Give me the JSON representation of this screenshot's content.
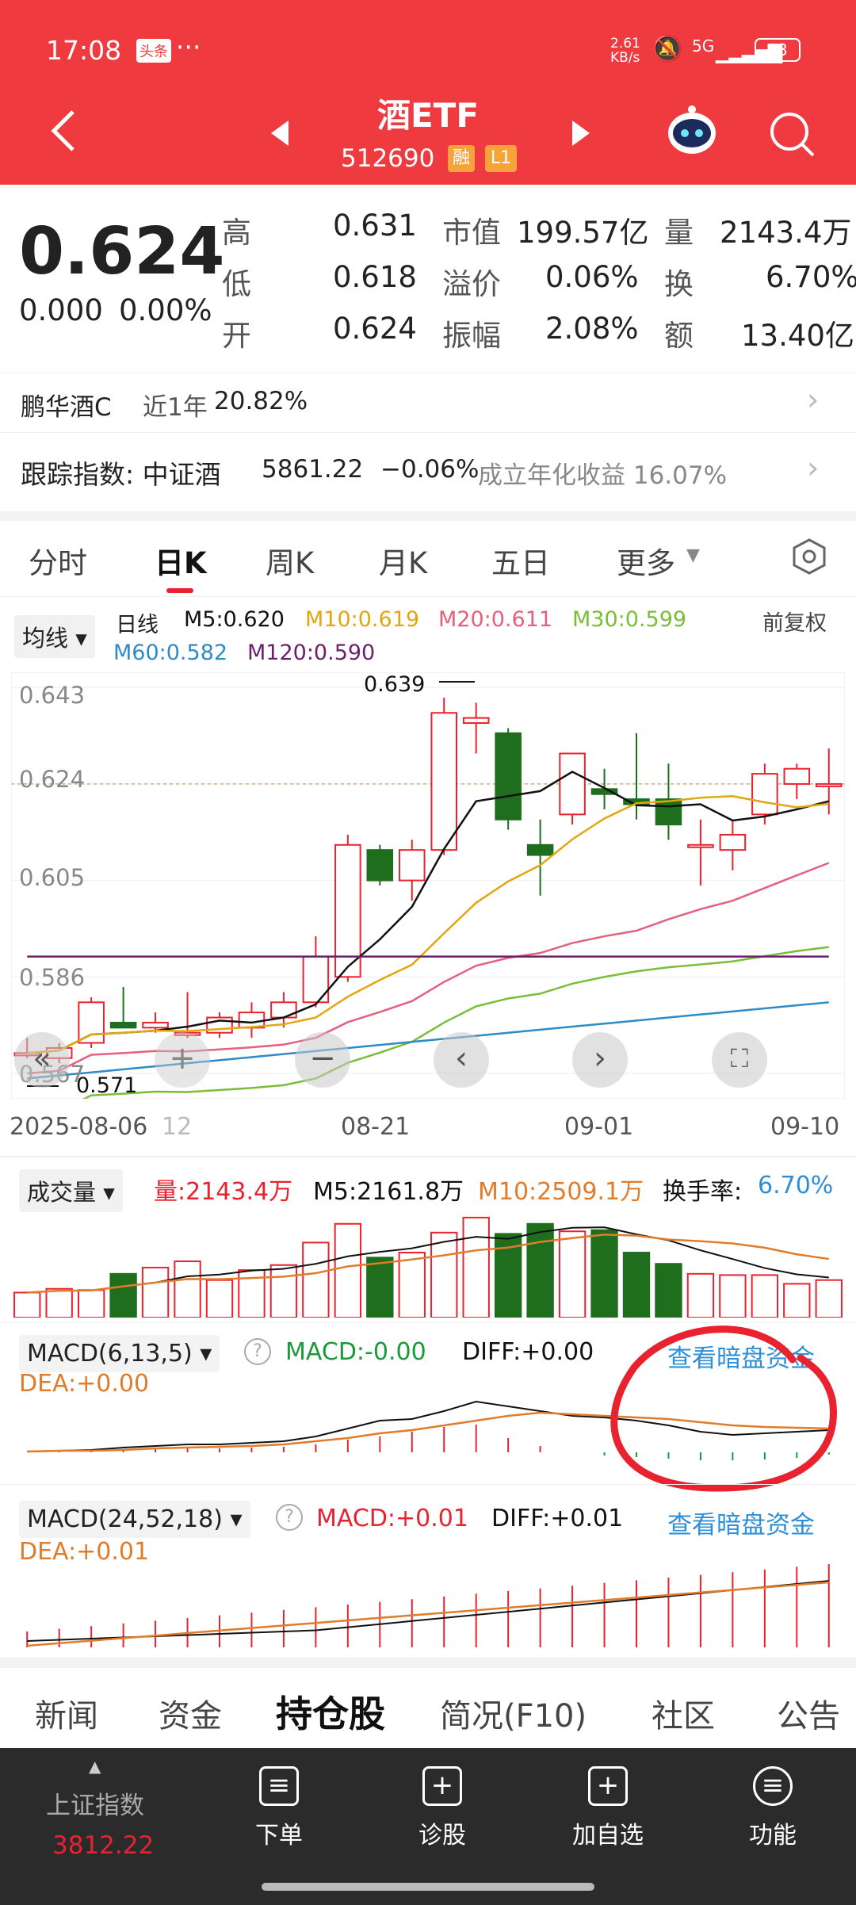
{
  "status": {
    "time": "17:08",
    "app_badge": "头条",
    "dots": "···",
    "speed": "2.61\nKB/s",
    "net": "5G",
    "battery": "53"
  },
  "header": {
    "title": "酒ETF",
    "code": "512690",
    "badge1": "融",
    "badge2": "L1"
  },
  "quote": {
    "price": "0.624",
    "change": "0.000",
    "change_pct": "0.00%",
    "high_label": "高",
    "high": "0.631",
    "low_label": "低",
    "low": "0.618",
    "open_label": "开",
    "open": "0.624",
    "mcap_label": "市值",
    "mcap": "199.57亿",
    "premium_label": "溢价",
    "premium": "0.06%",
    "amp_label": "振幅",
    "amp": "2.08%",
    "vol_label": "量",
    "vol": "2143.4万",
    "turn_label": "换",
    "turn": "6.70%",
    "amt_label": "额",
    "amt": "13.40亿"
  },
  "fund": {
    "name": "鹏华酒C",
    "period": "近1年",
    "ret": "20.82%"
  },
  "tracking": {
    "label": "跟踪指数: 中证酒",
    "value": "5861.22",
    "change": "−0.06%",
    "annual": "成立年化收益 16.07%"
  },
  "tabs": [
    "分时",
    "日K",
    "周K",
    "月K",
    "五日",
    "更多"
  ],
  "kchart": {
    "ma_selector": "均线",
    "period": "日线",
    "m5": "M5:0.620",
    "m10": "M10:0.619",
    "m20": "M20:0.611",
    "m30": "M30:0.599",
    "m60": "M60:0.582",
    "m120": "M120:0.590",
    "adjust": "前复权",
    "y_ticks": [
      "0.643",
      "0.624",
      "0.605",
      "0.586",
      "0.567"
    ],
    "max_label": "0.639",
    "min_label": "0.571",
    "x_ticks": [
      "2025-08-06",
      "12",
      "08-21",
      "09-01",
      "09-10"
    ]
  },
  "volume": {
    "selector": "成交量",
    "vol": "量:2143.4万",
    "m5": "M5:2161.8万",
    "m10": "M10:2509.1万",
    "turn_label": "换手率:",
    "turn": "6.70%"
  },
  "macd1": {
    "selector": "MACD(6,13,5)",
    "macd": "MACD:-0.00",
    "diff": "DIFF:+0.00",
    "dea": "DEA:+0.00",
    "link": "查看暗盘资金"
  },
  "macd2": {
    "selector": "MACD(24,52,18)",
    "macd": "MACD:+0.01",
    "diff": "DIFF:+0.01",
    "dea": "DEA:+0.01",
    "link": "查看暗盘资金"
  },
  "bottom_tabs": [
    "新闻",
    "资金",
    "持仓股",
    "简况(F10)",
    "社区",
    "公告"
  ],
  "nav": {
    "index_name": "上证指数",
    "index_value": "3812.22",
    "items": [
      "下单",
      "诊股",
      "加自选",
      "功能"
    ]
  },
  "colors": {
    "header": "#ef3a3f",
    "up": "#e8222e",
    "down": "#1e6e1e"
  },
  "chart_data": [
    {
      "type": "candlestick",
      "title": "日线",
      "ylim": [
        0.562,
        0.646
      ],
      "x_labels": [
        "2025-08-06",
        "08-21",
        "09-01",
        "09-10"
      ],
      "candles": [
        [
          0.571,
          0.574,
          0.57,
          0.571
        ],
        [
          0.57,
          0.573,
          0.569,
          0.572
        ],
        [
          0.573,
          0.582,
          0.572,
          0.581
        ],
        [
          0.577,
          0.584,
          0.576,
          0.576
        ],
        [
          0.576,
          0.579,
          0.575,
          0.577
        ],
        [
          0.575,
          0.583,
          0.574,
          0.575
        ],
        [
          0.575,
          0.579,
          0.574,
          0.578
        ],
        [
          0.576,
          0.581,
          0.574,
          0.579
        ],
        [
          0.578,
          0.583,
          0.576,
          0.581
        ],
        [
          0.581,
          0.594,
          0.58,
          0.59
        ],
        [
          0.586,
          0.614,
          0.585,
          0.612
        ],
        [
          0.611,
          0.612,
          0.604,
          0.605
        ],
        [
          0.605,
          0.613,
          0.601,
          0.611
        ],
        [
          0.611,
          0.641,
          0.61,
          0.638
        ],
        [
          0.636,
          0.64,
          0.63,
          0.637
        ],
        [
          0.634,
          0.635,
          0.615,
          0.617
        ],
        [
          0.612,
          0.617,
          0.602,
          0.61
        ],
        [
          0.618,
          0.629,
          0.616,
          0.63
        ],
        [
          0.623,
          0.627,
          0.619,
          0.622
        ],
        [
          0.621,
          0.634,
          0.617,
          0.62
        ],
        [
          0.621,
          0.628,
          0.613,
          0.616
        ],
        [
          0.612,
          0.617,
          0.604,
          0.612
        ],
        [
          0.611,
          0.617,
          0.607,
          0.614
        ],
        [
          0.618,
          0.628,
          0.616,
          0.626
        ],
        [
          0.624,
          0.628,
          0.621,
          0.627
        ],
        [
          0.624,
          0.631,
          0.618,
          0.624
        ]
      ]
    },
    {
      "type": "bar",
      "title": "成交量",
      "values": [
        20,
        23,
        22,
        35,
        40,
        45,
        30,
        38,
        42,
        60,
        75,
        48,
        52,
        68,
        80,
        67,
        75,
        69,
        70,
        52,
        43,
        35,
        34,
        34,
        27,
        30
      ]
    },
    {
      "type": "bar",
      "title": "MACD(6,13,5)"
    },
    {
      "type": "bar",
      "title": "MACD(24,52,18)"
    }
  ]
}
